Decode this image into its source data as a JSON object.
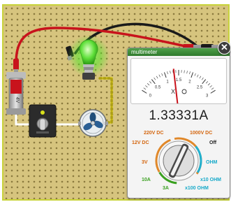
{
  "multimeter": {
    "title": "multimeter",
    "reading": "1.33331A",
    "gauge": {
      "scale_labels": [
        "0",
        "0.5",
        "1",
        "1.5",
        "2",
        "2.5",
        "3"
      ],
      "mode_symbols": "X",
      "needle_value": 1.33
    },
    "ranges": {
      "v_dc_220": "220V DC",
      "v_dc_1000": "1000V DC",
      "v_dc_12": "12V DC",
      "off": "Off",
      "v_3": "3V",
      "ohm": "OHM",
      "a_10": "10A",
      "ohm_x10": "x10 OHM",
      "a_3": "3A",
      "ohm_x100": "x100 OHM"
    },
    "selected_range": "3A"
  },
  "battery": {
    "label": "4V"
  },
  "colors": {
    "board": "#d6c47e",
    "board_border": "#c8d33a",
    "wire_red": "#c8131c",
    "wire_black": "#1a1a1a",
    "wire_yellow": "#e2d21a",
    "bulb_glow": "#52e52b",
    "meter_header": "#2f7a2c"
  },
  "icons": {
    "close": "close-icon",
    "bulb": "light-bulb-icon",
    "battery": "battery-icon",
    "switch": "toggle-switch-icon",
    "fan": "fan-icon"
  }
}
